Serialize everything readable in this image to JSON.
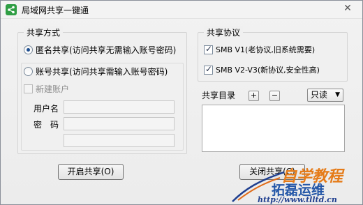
{
  "window": {
    "title": "局域网共享一键通",
    "close_symbol": "✕"
  },
  "share_mode": {
    "title": "共享方式",
    "anonymous_label": "匿名共享(访问共享无需输入账号密码)",
    "account_label": "账号共享(访问共享需输入账号密码)",
    "new_account_label": "新建账户",
    "username_label": "用户名",
    "password_label": "密　码",
    "username_value": "",
    "password_value": "",
    "confirm_value": "",
    "selected": "anonymous"
  },
  "protocol": {
    "title": "共享协议",
    "smb_v1_label": "SMB V1(老协议,旧系统需要)",
    "smb_v2_label": "SMB V2-V3(新协议,安全性高)",
    "smb_v1_checked": true,
    "smb_v2_checked": true
  },
  "directory": {
    "title": "共享目录",
    "add_symbol": "+",
    "remove_symbol": "−",
    "mode_value": "只读",
    "dropdown_arrow": "▼",
    "items": []
  },
  "actions": {
    "start_label": "开启共享(O)",
    "close_label": "关闭共享(C)"
  },
  "watermark": {
    "line1": "自学教程",
    "line2": "拓磊运维",
    "url": "http://www.tlltd.cn"
  }
}
